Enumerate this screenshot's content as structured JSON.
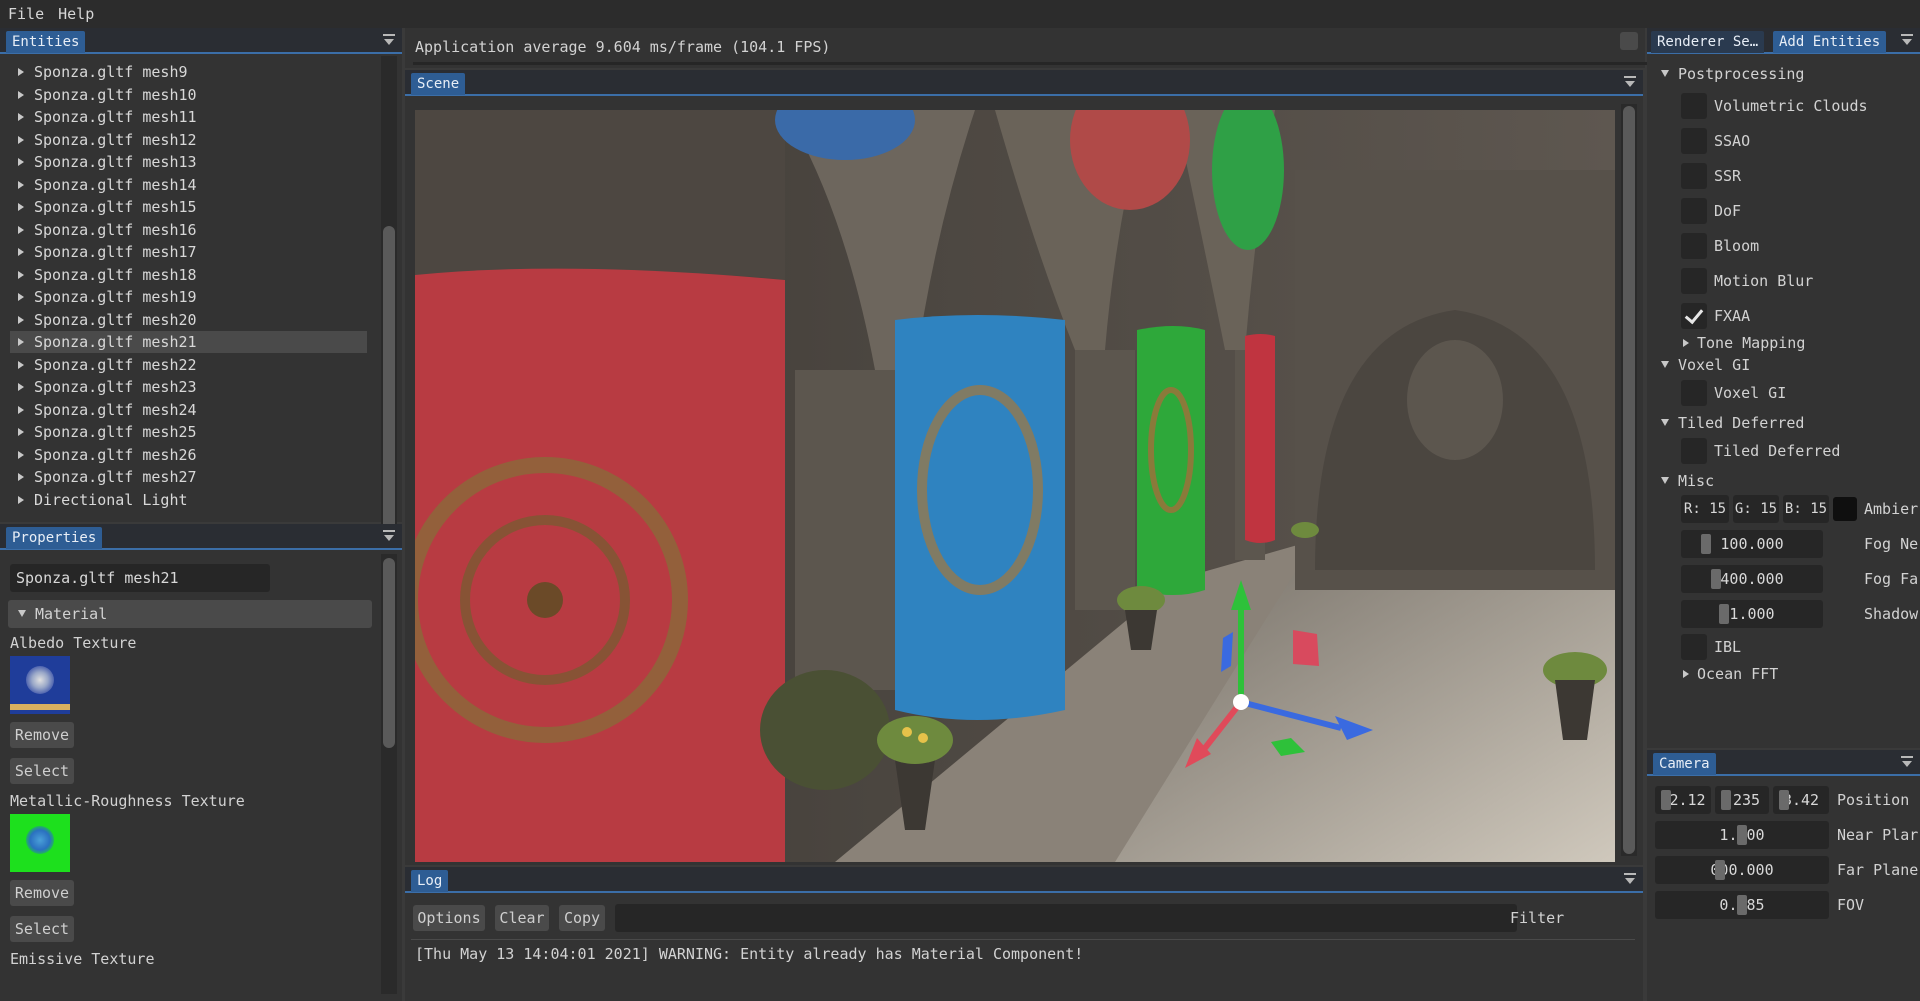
{
  "menu": [
    "File",
    "Help"
  ],
  "entities": {
    "tab": "Entities",
    "items": [
      {
        "label": "Sponza.gltf mesh9"
      },
      {
        "label": "Sponza.gltf mesh10"
      },
      {
        "label": "Sponza.gltf mesh11"
      },
      {
        "label": "Sponza.gltf mesh12"
      },
      {
        "label": "Sponza.gltf mesh13"
      },
      {
        "label": "Sponza.gltf mesh14"
      },
      {
        "label": "Sponza.gltf mesh15"
      },
      {
        "label": "Sponza.gltf mesh16"
      },
      {
        "label": "Sponza.gltf mesh17"
      },
      {
        "label": "Sponza.gltf mesh18"
      },
      {
        "label": "Sponza.gltf mesh19"
      },
      {
        "label": "Sponza.gltf mesh20"
      },
      {
        "label": "Sponza.gltf mesh21",
        "selected": true
      },
      {
        "label": "Sponza.gltf mesh22"
      },
      {
        "label": "Sponza.gltf mesh23"
      },
      {
        "label": "Sponza.gltf mesh24"
      },
      {
        "label": "Sponza.gltf mesh25"
      },
      {
        "label": "Sponza.gltf mesh26"
      },
      {
        "label": "Sponza.gltf mesh27"
      },
      {
        "label": "Directional Light"
      }
    ]
  },
  "properties": {
    "tab": "Properties",
    "name_value": "Sponza.gltf mesh21",
    "section": "Material",
    "albedo_label": "Albedo Texture",
    "mr_label": "Metallic-Roughness Texture",
    "emissive_label": "Emissive Texture",
    "remove": "Remove",
    "select": "Select"
  },
  "stats": "Application average 9.604 ms/frame (104.1 FPS)",
  "scene": {
    "tab": "Scene"
  },
  "log": {
    "tab": "Log",
    "options": "Options",
    "clear": "Clear",
    "copy": "Copy",
    "filter_label": "Filter",
    "message": "[Thu May 13 14:04:01 2021] WARNING: Entity already has Material Component!"
  },
  "renderer": {
    "tabs": [
      "Renderer Se…",
      "Add Entities"
    ],
    "postprocessing": "Postprocessing",
    "effects": [
      {
        "label": "Volumetric Clouds",
        "checked": false
      },
      {
        "label": "SSAO",
        "checked": false
      },
      {
        "label": "SSR",
        "checked": false
      },
      {
        "label": "DoF",
        "checked": false
      },
      {
        "label": "Bloom",
        "checked": false
      },
      {
        "label": "Motion Blur",
        "checked": false
      },
      {
        "label": "FXAA",
        "checked": true
      }
    ],
    "tone_mapping": "Tone Mapping",
    "voxel_header": "Voxel GI",
    "voxel_label": "Voxel GI",
    "tiled_header": "Tiled Deferred",
    "tiled_label": "Tiled Deferred",
    "misc_header": "Misc",
    "ambient": {
      "r": "R: 15",
      "g": "G: 15",
      "b": "B: 15",
      "label": "Ambier"
    },
    "fog_near": {
      "value": "100.000",
      "label": "Fog Ne"
    },
    "fog_far": {
      "value": "400.000",
      "label": "Fog Fa"
    },
    "shadow": {
      "value": "1.000",
      "label": "Shadow"
    },
    "ibl": "IBL",
    "ocean": "Ocean FFT"
  },
  "camera": {
    "tab": "Camera",
    "pos_x": "82.12",
    "pos_y": ".235",
    "pos_z": "3.42",
    "position_label": "Position",
    "near": "1.000",
    "near_label": "Near Plar",
    "far": "000.000",
    "far_label": "Far Plane",
    "fov": "0.785",
    "fov_label": "FOV"
  }
}
